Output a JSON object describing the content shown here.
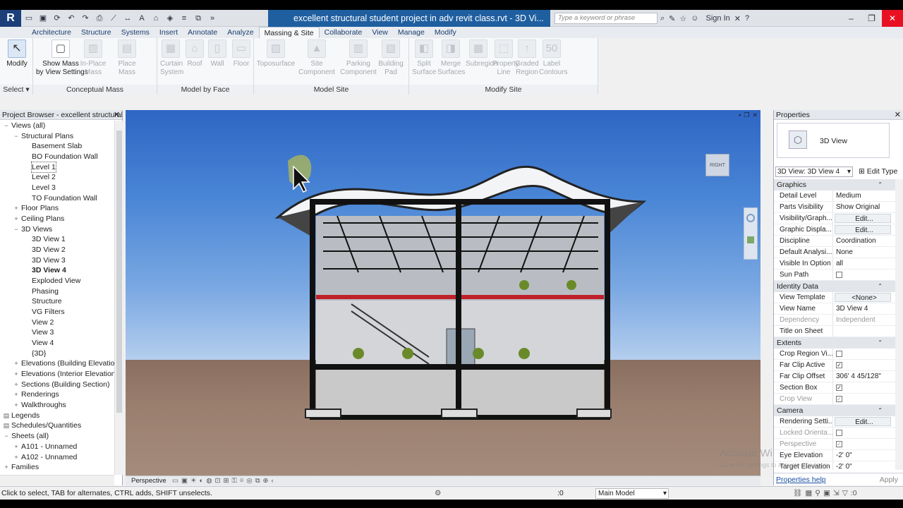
{
  "window": {
    "title": "excellent structural student project in adv revit class.rvt - 3D Vi...",
    "search_placeholder": "Type a keyword or phrase",
    "signin": "Sign In",
    "logo": "R"
  },
  "ribbon": {
    "tabs": [
      "Architecture",
      "Structure",
      "Systems",
      "Insert",
      "Annotate",
      "Analyze",
      "Massing & Site",
      "Collaborate",
      "View",
      "Manage",
      "Modify"
    ],
    "active_tab": "Massing & Site",
    "modify_label": "Modify",
    "select_label": "Select",
    "groups": {
      "conceptual_mass": {
        "title": "Conceptual Mass",
        "tools": [
          "Show Mass\nby View Settings",
          "In-Place\nMass",
          "Place\nMass"
        ]
      },
      "model_by_face": {
        "title": "Model by Face",
        "tools": [
          "Curtain\nSystem",
          "Roof",
          "Wall",
          "Floor"
        ]
      },
      "model_site": {
        "title": "Model Site",
        "tools": [
          "Toposurface",
          "Site\nComponent",
          "Parking\nComponent",
          "Building\nPad"
        ]
      },
      "modify_site": {
        "title": "Modify Site",
        "tools": [
          "Split\nSurface",
          "Merge\nSurfaces",
          "Subregion",
          "Property\nLine",
          "Graded\nRegion",
          "Label\nContours"
        ]
      }
    }
  },
  "project_browser": {
    "title": "Project Browser - excellent structural...",
    "items": [
      {
        "label": "Views (all)",
        "level": 0,
        "tog": "−"
      },
      {
        "label": "Structural Plans",
        "level": 1,
        "tog": "−"
      },
      {
        "label": "Basement Slab",
        "level": 2
      },
      {
        "label": "BO Foundation Wall",
        "level": 2
      },
      {
        "label": "Level 1",
        "level": 2,
        "selected": true
      },
      {
        "label": "Level 2",
        "level": 2
      },
      {
        "label": "Level 3",
        "level": 2
      },
      {
        "label": "TO Foundation Wall",
        "level": 2
      },
      {
        "label": "Floor Plans",
        "level": 1,
        "tog": "+"
      },
      {
        "label": "Ceiling Plans",
        "level": 1,
        "tog": "+"
      },
      {
        "label": "3D Views",
        "level": 1,
        "tog": "−"
      },
      {
        "label": "3D View 1",
        "level": 2
      },
      {
        "label": "3D View 2",
        "level": 2
      },
      {
        "label": "3D View 3",
        "level": 2
      },
      {
        "label": "3D View 4",
        "level": 2,
        "bold": true
      },
      {
        "label": "Exploded View",
        "level": 2
      },
      {
        "label": "Phasing",
        "level": 2
      },
      {
        "label": "Structure",
        "level": 2
      },
      {
        "label": "VG Filters",
        "level": 2
      },
      {
        "label": "View 2",
        "level": 2
      },
      {
        "label": "View 3",
        "level": 2
      },
      {
        "label": "View 4",
        "level": 2
      },
      {
        "label": "{3D}",
        "level": 2
      },
      {
        "label": "Elevations (Building Elevatio",
        "level": 1,
        "tog": "+"
      },
      {
        "label": "Elevations (Interior Elevation",
        "level": 1,
        "tog": "+"
      },
      {
        "label": "Sections (Building Section)",
        "level": 1,
        "tog": "+"
      },
      {
        "label": "Renderings",
        "level": 1,
        "tog": "+"
      },
      {
        "label": "Walkthroughs",
        "level": 1,
        "tog": "+"
      },
      {
        "label": "Legends",
        "level": 0,
        "tog": "▤"
      },
      {
        "label": "Schedules/Quantities",
        "level": 0,
        "tog": "▤"
      },
      {
        "label": "Sheets (all)",
        "level": 0,
        "tog": "−"
      },
      {
        "label": "A101 - Unnamed",
        "level": 1,
        "tog": "+"
      },
      {
        "label": "A102 - Unnamed",
        "level": 1,
        "tog": "+"
      },
      {
        "label": "Families",
        "level": 0,
        "tog": "+"
      }
    ]
  },
  "viewport": {
    "viewcube_label": "RIGHT",
    "viewbar_label": "Perspective"
  },
  "properties": {
    "title": "Properties",
    "type_name": "3D View",
    "instance_selector": "3D View: 3D View 4",
    "edit_type": "Edit Type",
    "groups": [
      {
        "name": "Graphics",
        "rows": [
          {
            "n": "Detail Level",
            "v": "Medium"
          },
          {
            "n": "Parts Visibility",
            "v": "Show Original"
          },
          {
            "n": "Visibility/Graph...",
            "v": "Edit...",
            "btn": true
          },
          {
            "n": "Graphic Displa...",
            "v": "Edit...",
            "btn": true
          },
          {
            "n": "Discipline",
            "v": "Coordination"
          },
          {
            "n": "Default Analysi...",
            "v": "None"
          },
          {
            "n": "Visible In Option",
            "v": "all"
          },
          {
            "n": "Sun Path",
            "v": "",
            "chk": "off"
          }
        ]
      },
      {
        "name": "Identity Data",
        "rows": [
          {
            "n": "View Template",
            "v": "<None>",
            "btn": true
          },
          {
            "n": "View Name",
            "v": "3D View 4"
          },
          {
            "n": "Dependency",
            "v": "Independent",
            "dim": true
          },
          {
            "n": "Title on Sheet",
            "v": ""
          }
        ]
      },
      {
        "name": "Extents",
        "rows": [
          {
            "n": "Crop Region Vi...",
            "v": "",
            "chk": "off"
          },
          {
            "n": "Far Clip Active",
            "v": "",
            "chk": "on"
          },
          {
            "n": "Far Clip Offset",
            "v": "306'  4 45/128\""
          },
          {
            "n": "Section Box",
            "v": "",
            "chk": "on"
          },
          {
            "n": "Crop View",
            "v": "",
            "chk": "on",
            "dim": true
          }
        ]
      },
      {
        "name": "Camera",
        "rows": [
          {
            "n": "Rendering Setti...",
            "v": "Edit...",
            "btn": true
          },
          {
            "n": "Locked Orienta...",
            "v": "",
            "chk": "off",
            "dim": true
          },
          {
            "n": "Perspective",
            "v": "",
            "chk": "on",
            "dim": true
          },
          {
            "n": "Eye Elevation",
            "v": "-2'  0\""
          },
          {
            "n": "Target Elevation",
            "v": "-2'  0\""
          }
        ]
      }
    ],
    "help_link": "Properties help",
    "apply": "Apply"
  },
  "watermark": {
    "line1": "Activate Wi",
    "line2": "Go to PC settings to activate Windows."
  },
  "status": {
    "message": "Click to select, TAB for alternates, CTRL adds, SHIFT unselects.",
    "zero": ":0",
    "model": "Main Model",
    "right_zero": ":0"
  },
  "colors": {
    "titlebar_accent": "#1f5fa0",
    "close_button": "#e81123",
    "revit_logo_bg": "#1c3f7a"
  }
}
